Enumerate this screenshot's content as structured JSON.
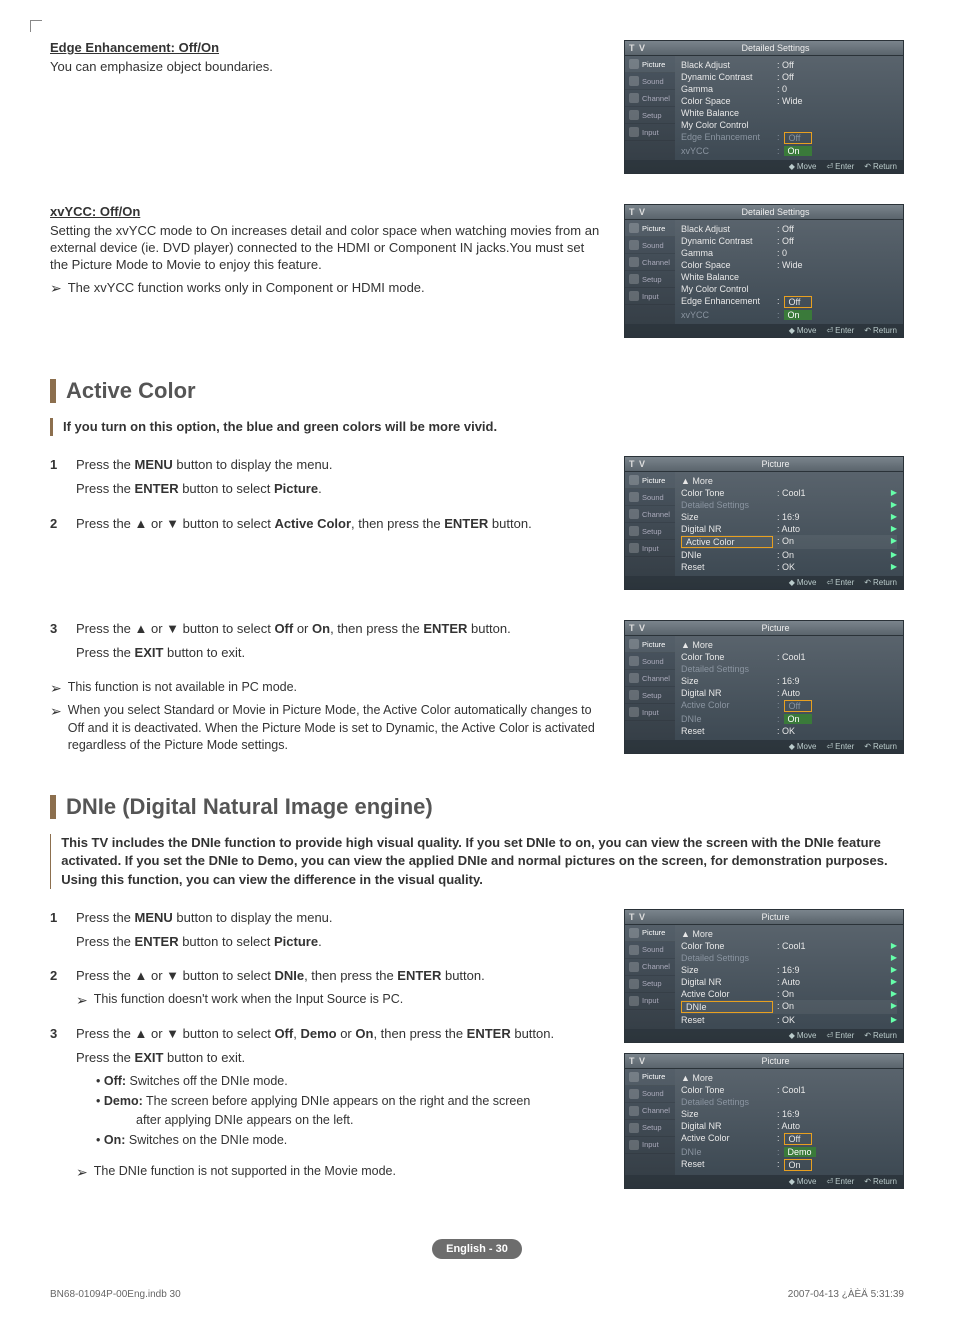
{
  "edge": {
    "heading": "Edge Enhancement: Off/On",
    "desc": "You can emphasize object boundaries."
  },
  "xvycc": {
    "heading": "xvYCC: Off/On",
    "desc": "Setting the xvYCC mode to On increases detail and color space when watching movies from an external device (ie. DVD player) connected to the HDMI or Component IN jacks.You must set the Picture Mode to Movie to enjoy this feature.",
    "note": "The xvYCC function works only in Component or HDMI mode."
  },
  "active_color": {
    "title": "Active Color",
    "intro": "If you turn on this option, the blue and green colors will be more vivid.",
    "steps": {
      "1a": "Press the MENU button to display the menu.",
      "1b": "Press the ENTER button to select Picture.",
      "2": "Press the ▲ or ▼ button to select Active Color, then press the ENTER button.",
      "3a": "Press the ▲ or ▼ button to select Off or On, then press the ENTER button.",
      "3b": "Press the EXIT button to exit."
    },
    "notes": {
      "n1": "This function is not available in PC mode.",
      "n2": "When you select Standard or Movie in Picture Mode, the Active Color automatically changes to Off and it is deactivated. When the Picture Mode is set to Dynamic, the Active Color is activated regardless of the Picture Mode settings."
    }
  },
  "dnie": {
    "title": "DNIe (Digital Natural Image engine)",
    "intro": "This TV includes the DNIe function to provide high visual quality. If you set DNIe to on, you can view the screen with the DNIe feature activated. If you set the DNIe to Demo, you can view the applied DNIe and normal pictures on the screen, for demonstration purposes. Using this function, you can view the difference in the visual quality.",
    "steps": {
      "1a": "Press the MENU button to display the menu.",
      "1b": "Press the ENTER button to select Picture.",
      "2": "Press the ▲ or ▼ button to select DNIe, then press the ENTER button.",
      "2note": "This function doesn't work when the Input Source is PC.",
      "3a": "Press the ▲ or ▼ button to select Off, Demo or On, then press the ENTER button.",
      "3b": "Press the EXIT button to exit."
    },
    "bullets": {
      "off": "Off: Switches off the DNIe mode.",
      "demo1": "Demo: The screen before applying DNIe appears on the right and the screen",
      "demo2": "after applying DNIe appears on the left.",
      "on": "On: Switches on the DNIe mode."
    },
    "final_note": "The DNIe function is not supported in the Movie mode."
  },
  "tv_footer": {
    "move": "Move",
    "enter": "Enter",
    "return": "Return"
  },
  "tv_side": {
    "picture": "Picture",
    "sound": "Sound",
    "channel": "Channel",
    "setup": "Setup",
    "input": "Input"
  },
  "detailed": {
    "title": "Detailed Settings",
    "rows": {
      "black": "Black Adjust",
      "black_v": ": Off",
      "dyn": "Dynamic Contrast",
      "dyn_v": ": Off",
      "gamma": "Gamma",
      "gamma_v": ": 0",
      "cspace": "Color Space",
      "cspace_v": ": Wide",
      "wb": "White Balance",
      "mcc": "My Color Control",
      "edge": "Edge Enhancement",
      "edge_v": "Off",
      "xvycc": "xvYCC",
      "xvycc_v": "On"
    }
  },
  "picture_menu": {
    "title": "Picture",
    "more": "▲ More",
    "rows": {
      "ct": "Color Tone",
      "ct_v": ": Cool1",
      "ds": "Detailed Settings",
      "size": "Size",
      "size_v": ": 16:9",
      "dnr": "Digital NR",
      "dnr_v": ": Auto",
      "ac": "Active Color",
      "ac_on": ": On",
      "ac_off": ": Off",
      "dnie": "DNIe",
      "dnie_on": ": On",
      "dnie_demo": "Demo",
      "reset": "Reset",
      "reset_v": ": OK"
    }
  },
  "page_label": "English - 30",
  "footer": {
    "left": "BN68-01094P-00Eng.indb   30",
    "right": "2007-04-13   ¿ÀÈÄ 5:31:39"
  }
}
